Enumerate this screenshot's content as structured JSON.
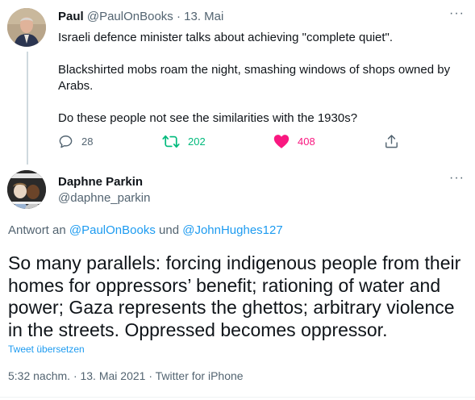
{
  "tweet1": {
    "name": "Paul",
    "handle": "@PaulOnBooks",
    "separator": "·",
    "date": "13. Mai",
    "more": "···",
    "lines": [
      "Israeli defence minister talks about achieving \"complete quiet\".",
      "Blackshirted mobs roam the night, smashing windows of shops owned by",
      "Arabs.",
      "Do these people not see the similarities with the 1930s?"
    ],
    "actions": {
      "replies": "28",
      "retweets": "202",
      "likes": "408"
    },
    "colors": {
      "retweet": "#00ba7c",
      "like": "#f91880",
      "icon": "#536471"
    }
  },
  "tweet2": {
    "name": "Daphne Parkin",
    "handle": "@daphne_parkin",
    "more": "···",
    "reply_prefix": "Antwort an",
    "reply_mention1": "@PaulOnBooks",
    "reply_and": "und",
    "reply_mention2": "@JohnHughes127",
    "text": "So many parallels: forcing indigenous people from their homes for oppressors’ benefit; rationing of water and power; Gaza represents the ghettos; arbitrary violence in the streets. Oppressed becomes oppressor.",
    "translate": "Tweet übersetzen",
    "meta": "5:32 nachm. · 13. Mai 2021 · Twitter for iPhone"
  }
}
